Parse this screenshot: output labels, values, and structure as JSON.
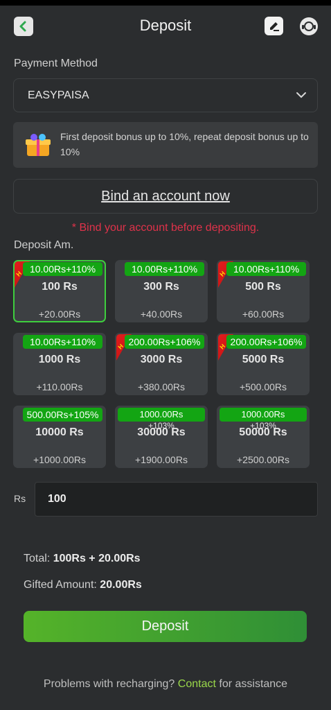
{
  "header": {
    "title": "Deposit",
    "back_icon": "back-arrow-icon",
    "edit_icon": "edit-record-icon",
    "support_icon": "customer-service-icon"
  },
  "payment": {
    "label": "Payment Method",
    "selected": "EASYPAISA"
  },
  "bonus": {
    "text": "First deposit bonus up to 10%, repeat deposit bonus up to 10%"
  },
  "bind": {
    "link": "Bind an account now",
    "warning": "* Bind your account before depositing."
  },
  "amounts": {
    "label": "Deposit Am.",
    "cards": [
      {
        "badge": "10.00Rs+110%",
        "badge_extra": "",
        "value": "100 Rs",
        "extra": "+20.00Rs",
        "hot": true,
        "selected": true
      },
      {
        "badge": "10.00Rs+110%",
        "badge_extra": "",
        "value": "300 Rs",
        "extra": "+40.00Rs",
        "hot": false,
        "selected": false
      },
      {
        "badge": "10.00Rs+110%",
        "badge_extra": "",
        "value": "500 Rs",
        "extra": "+60.00Rs",
        "hot": true,
        "selected": false
      },
      {
        "badge": "10.00Rs+110%",
        "badge_extra": "",
        "value": "1000 Rs",
        "extra": "+110.00Rs",
        "hot": false,
        "selected": false
      },
      {
        "badge": "200.00Rs+106%",
        "badge_extra": "",
        "value": "3000 Rs",
        "extra": "+380.00Rs",
        "hot": true,
        "selected": false
      },
      {
        "badge": "200.00Rs+106%",
        "badge_extra": "",
        "value": "5000 Rs",
        "extra": "+500.00Rs",
        "hot": true,
        "selected": false
      },
      {
        "badge": "500.00Rs+105%",
        "badge_extra": "",
        "value": "10000 Rs",
        "extra": "+1000.00Rs",
        "hot": false,
        "selected": false
      },
      {
        "badge": "1000.00Rs",
        "badge_extra": "+103%",
        "value": "30000 Rs",
        "extra": "+1900.00Rs",
        "hot": false,
        "selected": false
      },
      {
        "badge": "1000.00Rs",
        "badge_extra": "+103%",
        "value": "50000 Rs",
        "extra": "+2500.00Rs",
        "hot": false,
        "selected": false
      }
    ],
    "hot_letter": "H"
  },
  "input": {
    "currency": "Rs",
    "value": "100"
  },
  "summary": {
    "total_label": "Total:",
    "total_value": "100Rs + 20.00Rs",
    "gift_label": "Gifted Amount:",
    "gift_value": "20.00Rs"
  },
  "deposit_button": "Deposit",
  "footer": {
    "prefix": "Problems with recharging? ",
    "contact": "Contact",
    "suffix": " for assistance"
  },
  "colors": {
    "background": "#2b2d2f",
    "accent_green": "#13a513",
    "warning_red": "#e0324a",
    "contact_green": "#9ad84a"
  }
}
